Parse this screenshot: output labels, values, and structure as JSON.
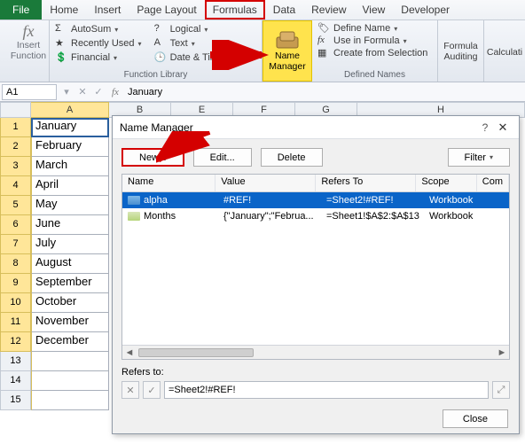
{
  "tabs": {
    "file": "File",
    "home": "Home",
    "insert": "Insert",
    "page_layout": "Page Layout",
    "formulas": "Formulas",
    "data": "Data",
    "review": "Review",
    "view": "View",
    "developer": "Developer"
  },
  "ribbon": {
    "insert_function": "Insert Function",
    "autosum": "AutoSum",
    "recently_used": "Recently Used",
    "financial": "Financial",
    "logical": "Logical",
    "text": "Text",
    "date_time": "Date & Time",
    "function_library": "Function Library",
    "name_manager": "Name Manager",
    "define_name": "Define Name",
    "use_in_formula": "Use in Formula",
    "create_from_selection": "Create from Selection",
    "defined_names": "Defined Names",
    "formula_auditing": "Formula Auditing",
    "calculation": "Calculati"
  },
  "formula_bar": {
    "name_box": "A1",
    "value": "January"
  },
  "columns": [
    "A",
    "B",
    "E",
    "F",
    "G",
    "H"
  ],
  "rows": [
    {
      "n": "1",
      "v": "January"
    },
    {
      "n": "2",
      "v": "February"
    },
    {
      "n": "3",
      "v": "March"
    },
    {
      "n": "4",
      "v": "April"
    },
    {
      "n": "5",
      "v": "May"
    },
    {
      "n": "6",
      "v": "June"
    },
    {
      "n": "7",
      "v": "July"
    },
    {
      "n": "8",
      "v": "August"
    },
    {
      "n": "9",
      "v": "September"
    },
    {
      "n": "10",
      "v": "October"
    },
    {
      "n": "11",
      "v": "November"
    },
    {
      "n": "12",
      "v": "December"
    },
    {
      "n": "13",
      "v": ""
    },
    {
      "n": "14",
      "v": ""
    },
    {
      "n": "15",
      "v": ""
    }
  ],
  "dialog": {
    "title": "Name Manager",
    "new": "New...",
    "edit": "Edit...",
    "delete": "Delete",
    "filter": "Filter",
    "hdr": {
      "name": "Name",
      "value": "Value",
      "refers": "Refers To",
      "scope": "Scope",
      "comment": "Com"
    },
    "items": [
      {
        "name": "alpha",
        "value": "#REF!",
        "refers": "=Sheet2!#REF!",
        "scope": "Workbook"
      },
      {
        "name": "Months",
        "value": "{\"January\";\"Februa...",
        "refers": "=Sheet1!$A$2:$A$13",
        "scope": "Workbook"
      }
    ],
    "refers_label": "Refers to:",
    "refers_value": "=Sheet2!#REF!",
    "close": "Close"
  }
}
